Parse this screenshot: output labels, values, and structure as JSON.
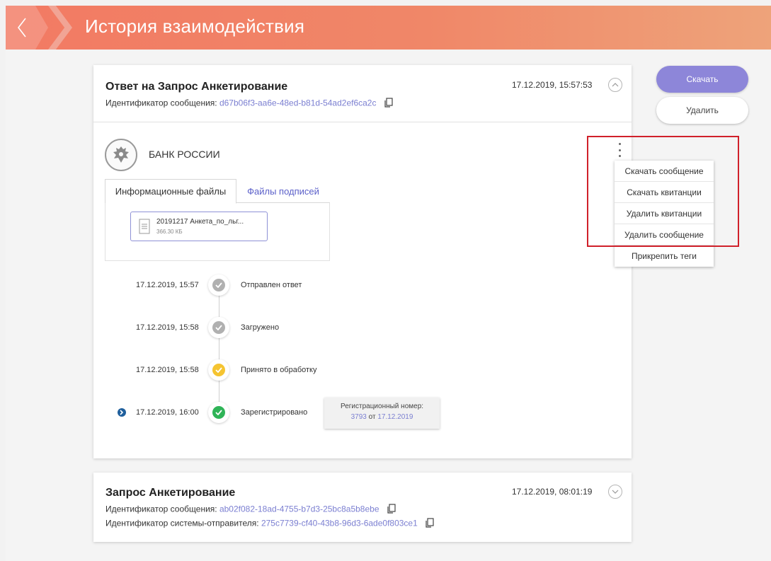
{
  "header": {
    "title": "История взаимодействия"
  },
  "actions": {
    "download": "Скачать",
    "delete": "Удалить"
  },
  "message1": {
    "title": "Ответ на Запрос Анкетирование",
    "id_label": "Идентификатор сообщения:",
    "id_value": "d67b06f3-aa6e-48ed-b81d-54ad2ef6ca2c",
    "datetime": "17.12.2019, 15:57:53",
    "sender": "БАНК РОССИИ",
    "tabs": [
      "Информационные файлы",
      "Файлы подписей"
    ],
    "file": {
      "name": "20191217 Анкета_по_льг...",
      "size": "366.30 КБ"
    },
    "timeline": [
      {
        "date": "17.12.2019, 15:57",
        "status": "Отправлен ответ",
        "color": "#b0b0b0"
      },
      {
        "date": "17.12.2019, 15:58",
        "status": "Загружено",
        "color": "#b0b0b0"
      },
      {
        "date": "17.12.2019, 15:58",
        "status": "Принято в обработку",
        "color": "#f5c431"
      },
      {
        "date": "17.12.2019, 16:00",
        "status": "Зарегистрировано",
        "color": "#2fb457"
      }
    ],
    "registration": {
      "label": "Регистрационный номер:",
      "number": "3793",
      "from_word": "от",
      "date": "17.12.2019"
    }
  },
  "context_menu": [
    "Скачать сообщение",
    "Скачать квитанции",
    "Удалить квитанции",
    "Удалить сообщение",
    "Прикрепить теги"
  ],
  "message2": {
    "title": "Запрос Анкетирование",
    "id_label": "Идентификатор сообщения:",
    "id_value": "ab02f082-18ad-4755-b7d3-25bc8a5b8ebe",
    "sys_label": "Идентификатор системы-отправителя:",
    "sys_value": "275c7739-cf40-43b8-96d3-6ade0f803ce1",
    "datetime": "17.12.2019, 08:01:19"
  },
  "colors": {
    "accent": "#8d86d9",
    "link": "#7b7fd1",
    "header_start": "#f27a63",
    "header_end": "#eea37a",
    "highlight": "#d0202a"
  }
}
